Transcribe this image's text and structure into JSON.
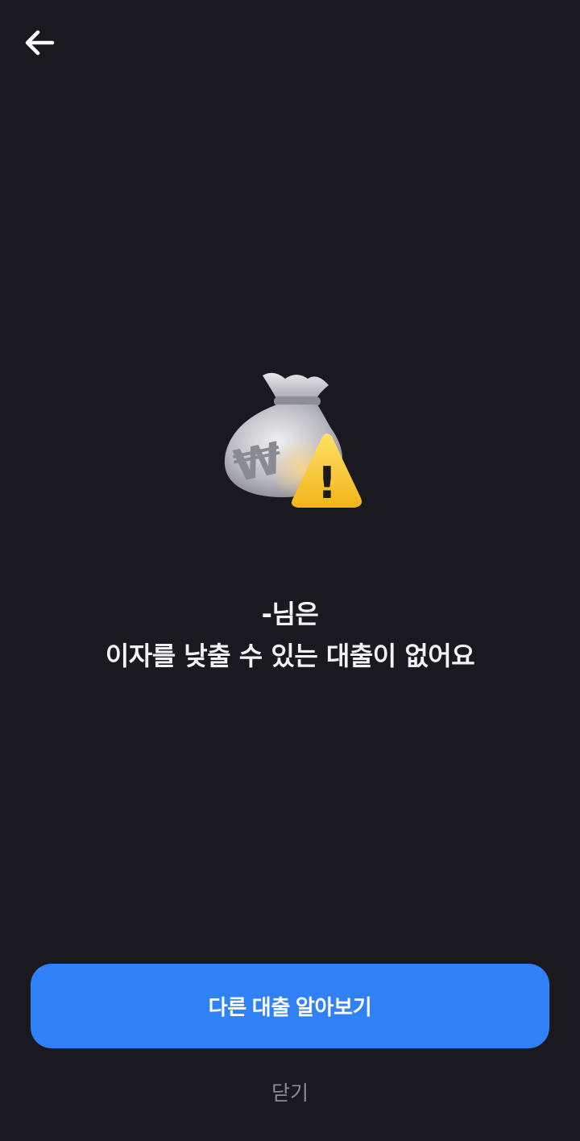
{
  "header": {
    "back_icon": "arrow-left-icon"
  },
  "illustration": {
    "icon": "money-bag-warning-icon",
    "currency_symbol": "₩",
    "warning_symbol": "!"
  },
  "message": {
    "line1": "-님은",
    "line2": "이자를 낮출 수 있는 대출이 없어요"
  },
  "actions": {
    "primary_label": "다른 대출 알아보기",
    "close_label": "닫기"
  },
  "colors": {
    "background": "#1a191f",
    "primary": "#3181f6",
    "text": "#f2f2f5",
    "muted": "#8b8b93",
    "warning": "#f7c52b"
  }
}
